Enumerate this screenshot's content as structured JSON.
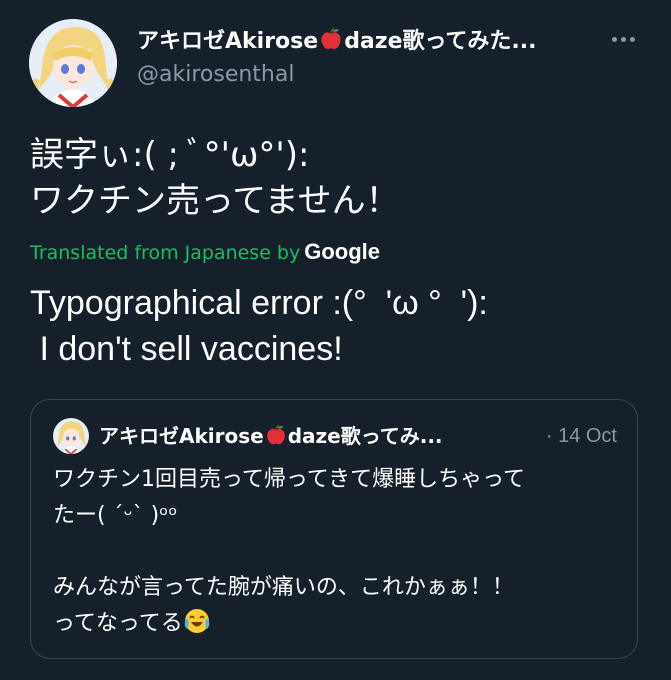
{
  "author": {
    "name": "アキロゼAkirose",
    "name_suffix": "daze歌ってみた...",
    "handle": "@akirosenthal"
  },
  "tweet": {
    "lines": [
      "誤字ぃ:( ; ﾞ°'ω°'):",
      "ワクチン売ってません！"
    ]
  },
  "translation": {
    "label": "Translated from Japanese by",
    "provider": "Google",
    "lines": [
      "Typographical error :(°  'ω °  '):",
      " I don't sell vaccines!"
    ]
  },
  "quoted_tweet": {
    "name": "アキロゼAkirose",
    "name_suffix": "daze歌ってみ...",
    "date": "· 14 Oct",
    "lines": [
      "ワクチン1回目売って帰ってきて爆睡しちゃって",
      "たー( ˊᵕˋ )ᵒᵒ",
      "",
      "みんなが言ってた腕が痛いの、これかぁぁ！！",
      "ってなってる"
    ]
  },
  "icons": {
    "apple": "red-apple-emoji",
    "more": "more-dots-icon",
    "cry": "crying-laughing-emoji"
  },
  "colors": {
    "background": "#15202b",
    "secondary_text": "#8b98a5",
    "translate_green": "#17bf63",
    "border": "#38444d"
  }
}
